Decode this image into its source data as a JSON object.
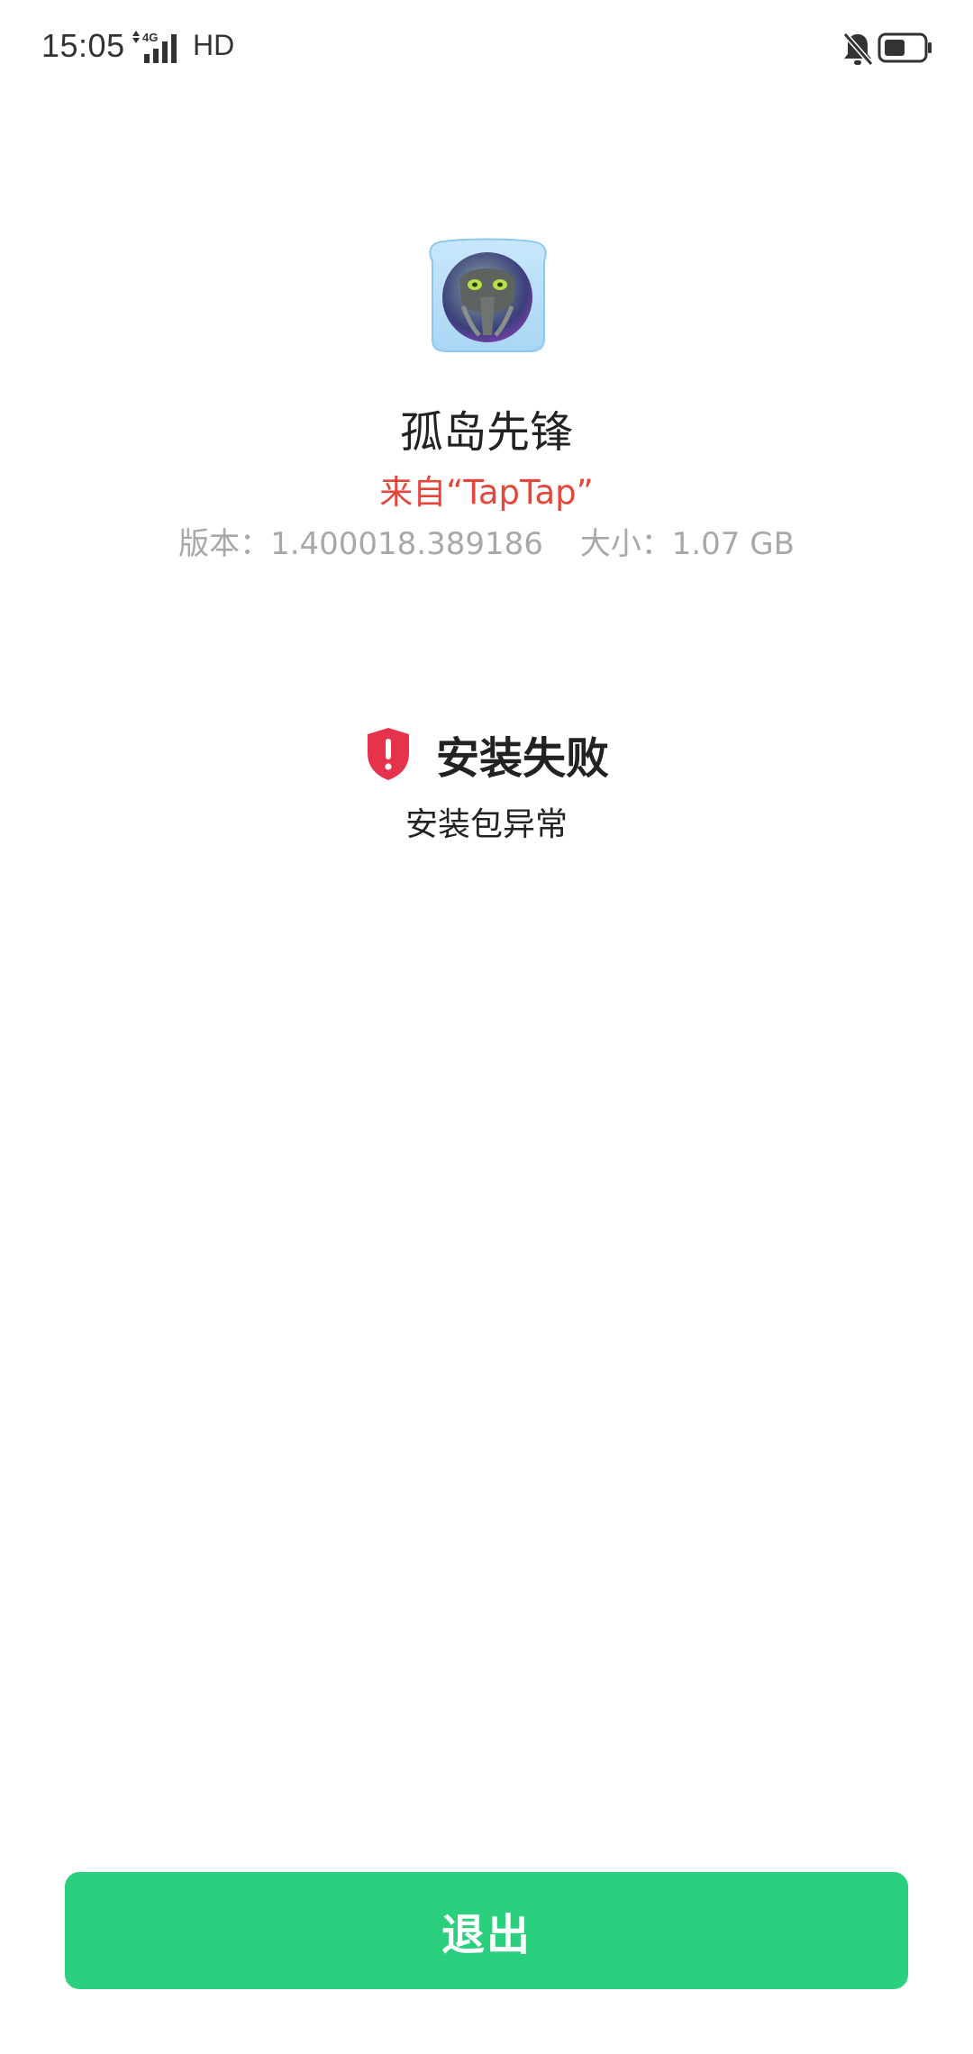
{
  "status_bar": {
    "time": "15:05",
    "network": "4G",
    "hd": "HD",
    "icons": [
      "signal-icon",
      "mute-bell-icon",
      "battery-icon"
    ]
  },
  "app": {
    "name": "孤岛先锋",
    "source": "来自“TapTap”",
    "version_text": "版本：1.400018.389186",
    "size_text": "大小：1.07 GB",
    "icon": "app-icon"
  },
  "result": {
    "title": "安装失败",
    "description": "安装包异常",
    "icon": "shield-alert-icon",
    "icon_color": "#e5334b"
  },
  "actions": {
    "exit_label": "退出",
    "exit_color": "#2bd07e"
  }
}
